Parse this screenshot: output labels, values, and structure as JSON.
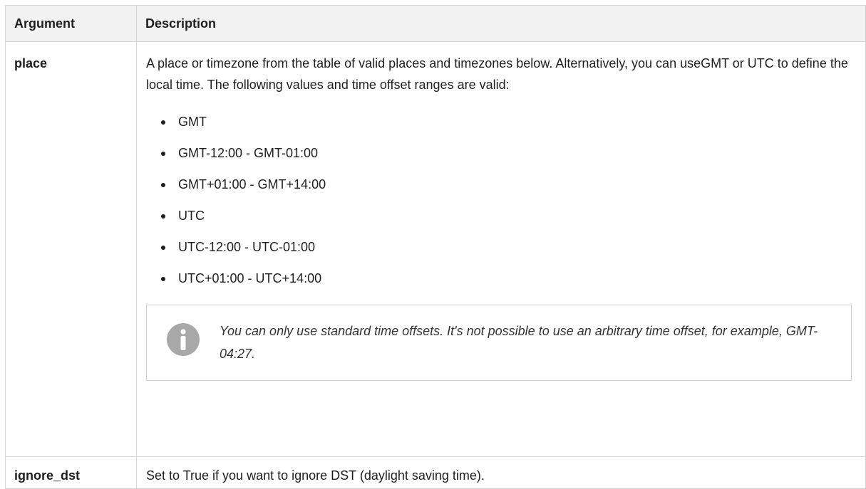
{
  "table": {
    "headers": [
      "Argument",
      "Description"
    ],
    "rows": [
      {
        "argument": "place",
        "description": "A place or timezone from the table of valid places and timezones below. Alternatively, you can useGMT or UTC to define the local time. The following values and time offset ranges are valid:",
        "values": [
          "GMT",
          "GMT-12:00 - GMT-01:00",
          "GMT+01:00 - GMT+14:00",
          "UTC",
          "UTC-12:00 - UTC-01:00",
          "UTC+01:00 - UTC+14:00"
        ],
        "note": {
          "icon": "info-icon",
          "text": "You can only use standard time offsets. It's not possible to use an arbitrary time offset, for example, GMT-04:27."
        }
      },
      {
        "argument": "ignore_dst",
        "description": "Set to True if you want to ignore DST (daylight saving time)."
      }
    ]
  },
  "colors": {
    "header_bg": "#f2f2f2",
    "border": "#d6d6d6",
    "icon": "#a8a8a8"
  }
}
